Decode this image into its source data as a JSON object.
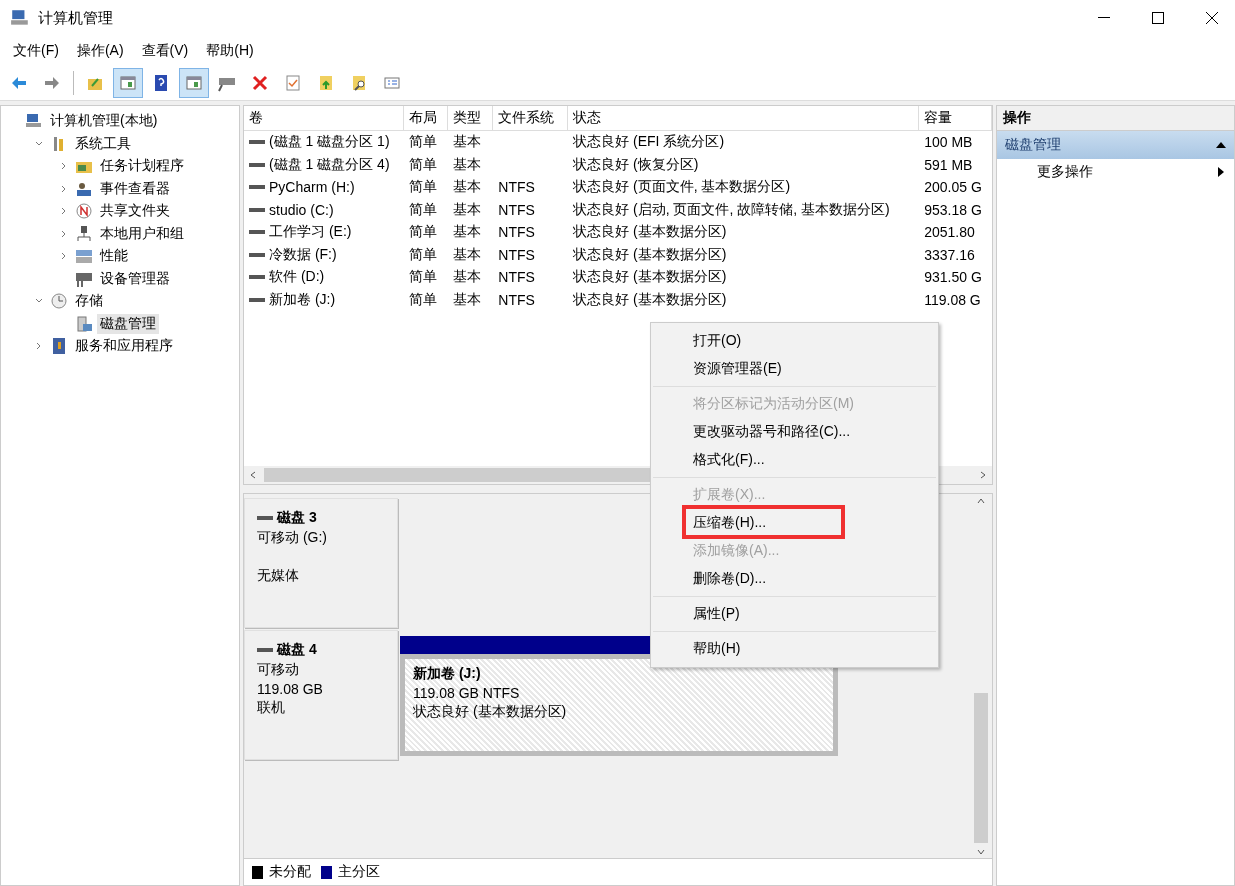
{
  "window": {
    "title": "计算机管理"
  },
  "menu": [
    "文件(F)",
    "操作(A)",
    "查看(V)",
    "帮助(H)"
  ],
  "toolbar": [
    {
      "kind": "back",
      "pressed": false
    },
    {
      "kind": "forward",
      "pressed": false
    },
    {
      "kind": "sep"
    },
    {
      "kind": "up",
      "pressed": false
    },
    {
      "kind": "pane",
      "pressed": true
    },
    {
      "kind": "help",
      "pressed": false
    },
    {
      "kind": "pane",
      "pressed": true
    },
    {
      "kind": "drive",
      "pressed": false
    },
    {
      "kind": "delete",
      "pressed": false
    },
    {
      "kind": "check",
      "pressed": false
    },
    {
      "kind": "upload",
      "pressed": false
    },
    {
      "kind": "find",
      "pressed": false
    },
    {
      "kind": "props",
      "pressed": false
    }
  ],
  "tree": [
    {
      "label": "计算机管理(本地)",
      "selected": false,
      "children": [
        {
          "label": "系统工具",
          "expanded": true,
          "selected": false,
          "children": [
            {
              "label": "任务计划程序",
              "expanded": false,
              "selected": false
            },
            {
              "label": "事件查看器",
              "expanded": false,
              "selected": false
            },
            {
              "label": "共享文件夹",
              "expanded": false,
              "selected": false
            },
            {
              "label": "本地用户和组",
              "expanded": false,
              "selected": false
            },
            {
              "label": "性能",
              "expanded": false,
              "selected": false
            },
            {
              "label": "设备管理器",
              "selected": false
            }
          ]
        },
        {
          "label": "存储",
          "expanded": true,
          "selected": false,
          "children": [
            {
              "label": "磁盘管理",
              "selected": true
            }
          ]
        },
        {
          "label": "服务和应用程序",
          "expanded": false,
          "selected": false
        }
      ]
    }
  ],
  "table": {
    "columns": [
      "卷",
      "布局",
      "类型",
      "文件系统",
      "状态",
      "容量"
    ],
    "rows": [
      [
        "(磁盘 1 磁盘分区 1)",
        "简单",
        "基本",
        "",
        "状态良好 (EFI 系统分区)",
        "100 MB"
      ],
      [
        "(磁盘 1 磁盘分区 4)",
        "简单",
        "基本",
        "",
        "状态良好 (恢复分区)",
        "591 MB"
      ],
      [
        "PyCharm (H:)",
        "简单",
        "基本",
        "NTFS",
        "状态良好 (页面文件, 基本数据分区)",
        "200.05 G"
      ],
      [
        "studio (C:)",
        "简单",
        "基本",
        "NTFS",
        "状态良好 (启动, 页面文件, 故障转储, 基本数据分区)",
        "953.18 G"
      ],
      [
        "工作学习 (E:)",
        "简单",
        "基本",
        "NTFS",
        "状态良好 (基本数据分区)",
        "2051.80"
      ],
      [
        "冷数据 (F:)",
        "简单",
        "基本",
        "NTFS",
        "状态良好 (基本数据分区)",
        "3337.16"
      ],
      [
        "软件 (D:)",
        "简单",
        "基本",
        "NTFS",
        "状态良好 (基本数据分区)",
        "931.50 G"
      ],
      [
        "新加卷 (J:)",
        "简单",
        "基本",
        "NTFS",
        "状态良好 (基本数据分区)",
        "119.08 G"
      ]
    ]
  },
  "disks": [
    {
      "name": "磁盘 3",
      "type": "可移动 (G:)",
      "status": "无媒体"
    },
    {
      "name": "磁盘 4",
      "type": "可移动",
      "size": "119.08 GB",
      "status": "联机",
      "partitions": [
        {
          "name": "新加卷  (J:)",
          "size": "119.08 GB NTFS",
          "status": "状态良好 (基本数据分区)",
          "color": "#00008b",
          "selected": true
        }
      ]
    }
  ],
  "legend": [
    {
      "label": "未分配",
      "color": "#000000"
    },
    {
      "label": "主分区",
      "color": "#00008b"
    }
  ],
  "actions": {
    "title": "操作",
    "section": "磁盘管理",
    "items": [
      "更多操作"
    ]
  },
  "context_menu": [
    {
      "kind": "item",
      "label": "打开(O)",
      "disabled": false,
      "highlighted": false
    },
    {
      "kind": "item",
      "label": "资源管理器(E)",
      "disabled": false,
      "highlighted": false
    },
    {
      "kind": "separator"
    },
    {
      "kind": "item",
      "label": "将分区标记为活动分区(M)",
      "disabled": true,
      "highlighted": false
    },
    {
      "kind": "item",
      "label": "更改驱动器号和路径(C)...",
      "disabled": false,
      "highlighted": false
    },
    {
      "kind": "item",
      "label": "格式化(F)...",
      "disabled": false,
      "highlighted": false
    },
    {
      "kind": "separator"
    },
    {
      "kind": "item",
      "label": "扩展卷(X)...",
      "disabled": true,
      "highlighted": false
    },
    {
      "kind": "item",
      "label": "压缩卷(H)...",
      "disabled": false,
      "highlighted": true
    },
    {
      "kind": "item",
      "label": "添加镜像(A)...",
      "disabled": true,
      "highlighted": false
    },
    {
      "kind": "item",
      "label": "删除卷(D)...",
      "disabled": false,
      "highlighted": false
    },
    {
      "kind": "separator"
    },
    {
      "kind": "item",
      "label": "属性(P)",
      "disabled": false,
      "highlighted": false
    },
    {
      "kind": "separator"
    },
    {
      "kind": "item",
      "label": "帮助(H)",
      "disabled": false,
      "highlighted": false
    }
  ]
}
